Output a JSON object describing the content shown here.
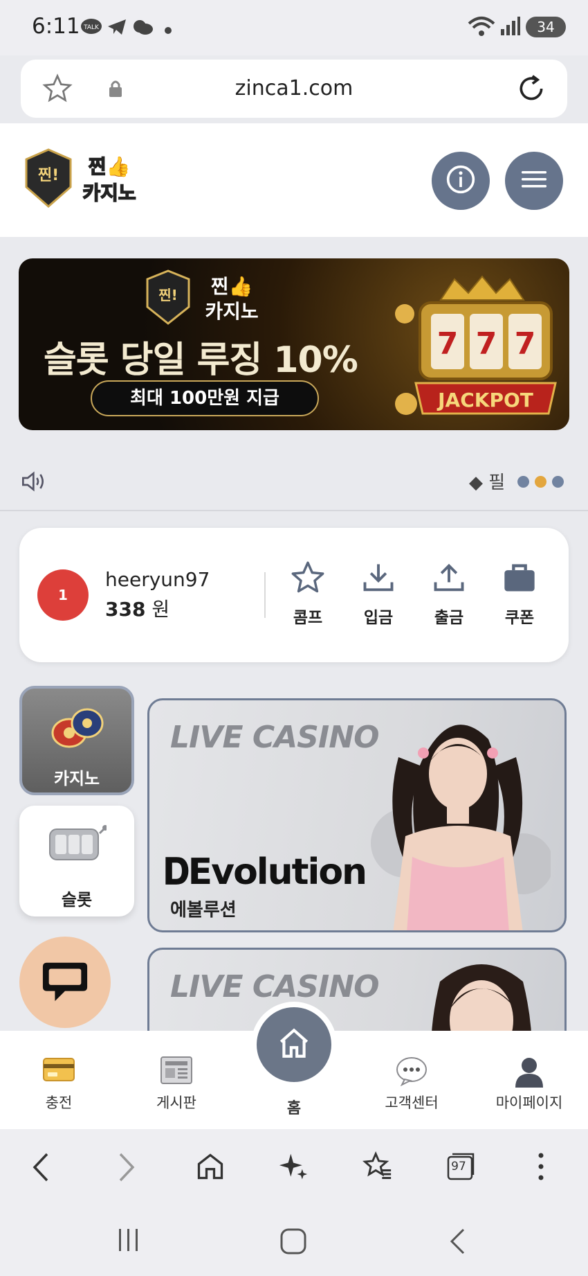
{
  "status": {
    "time": "6:11",
    "battery": "34"
  },
  "browser": {
    "url": "zinca1.com",
    "tab_count": "97"
  },
  "site": {
    "brand": "찐 카지노"
  },
  "banner": {
    "headline": "슬롯 당일 루징 10%",
    "subtext": "최대 100만원 지급",
    "jackpot_text": "JACKPOT"
  },
  "ticker": {
    "text": "◆ 필"
  },
  "user": {
    "level": "1",
    "username": "heeryun97",
    "balance": "338",
    "currency": "원"
  },
  "actions": [
    {
      "label": "콤프",
      "icon": "star-icon"
    },
    {
      "label": "입금",
      "icon": "download-icon"
    },
    {
      "label": "출금",
      "icon": "upload-icon"
    },
    {
      "label": "쿠폰",
      "icon": "briefcase-icon"
    }
  ],
  "categories": [
    {
      "label": "카지노",
      "active": true
    },
    {
      "label": "슬롯",
      "active": false
    }
  ],
  "games": [
    {
      "title": "LIVE CASINO",
      "provider": "Evolution",
      "provider_kr": "에볼루션"
    },
    {
      "title": "LIVE CASINO"
    }
  ],
  "bottom_nav": {
    "charge": "충전",
    "board": "게시판",
    "home": "홈",
    "support": "고객센터",
    "mypage": "마이페이지"
  },
  "colors": {
    "accent": "#66748c",
    "level_badge": "#dd3f3a",
    "active_dot": "#e3a63e",
    "chat_fab": "#f1c7a6"
  }
}
